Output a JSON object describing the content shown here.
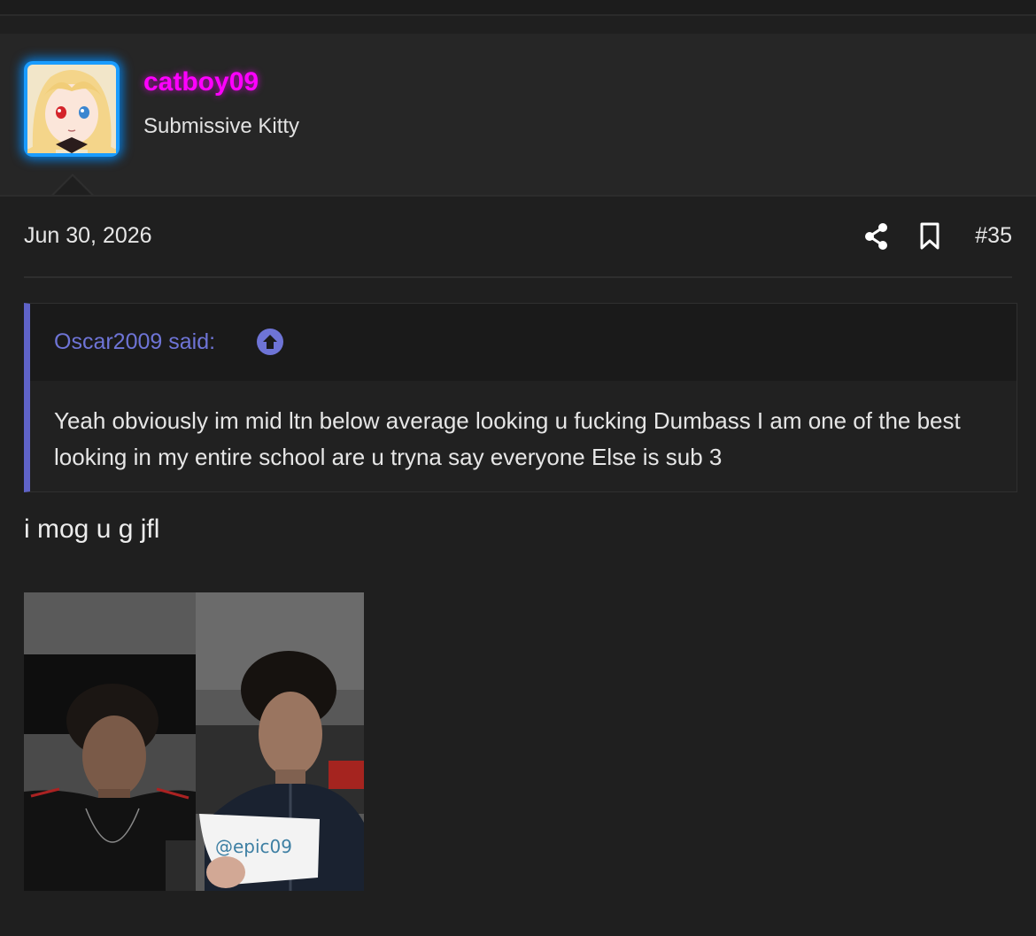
{
  "author": {
    "username": "catboy09",
    "title": "Submissive Kitty",
    "username_color": "#ff00ff",
    "avatar_border_color": "#1a9cff"
  },
  "post": {
    "date": "Jun 30, 2026",
    "number": "#35",
    "actions": [
      "share-icon",
      "bookmark-icon"
    ],
    "quote": {
      "attribution": "Oscar2009 said:",
      "text": "Yeah obviously im mid ltn below average looking u fucking Dumbass I am one of the best looking in my entire school are u tryna say everyone Else is sub 3",
      "accent_color": "#5f63c8"
    },
    "body": "i mog u g jfl",
    "attachments": [
      {
        "kind": "photo"
      },
      {
        "kind": "photo",
        "note_text": "@epic09"
      }
    ]
  }
}
